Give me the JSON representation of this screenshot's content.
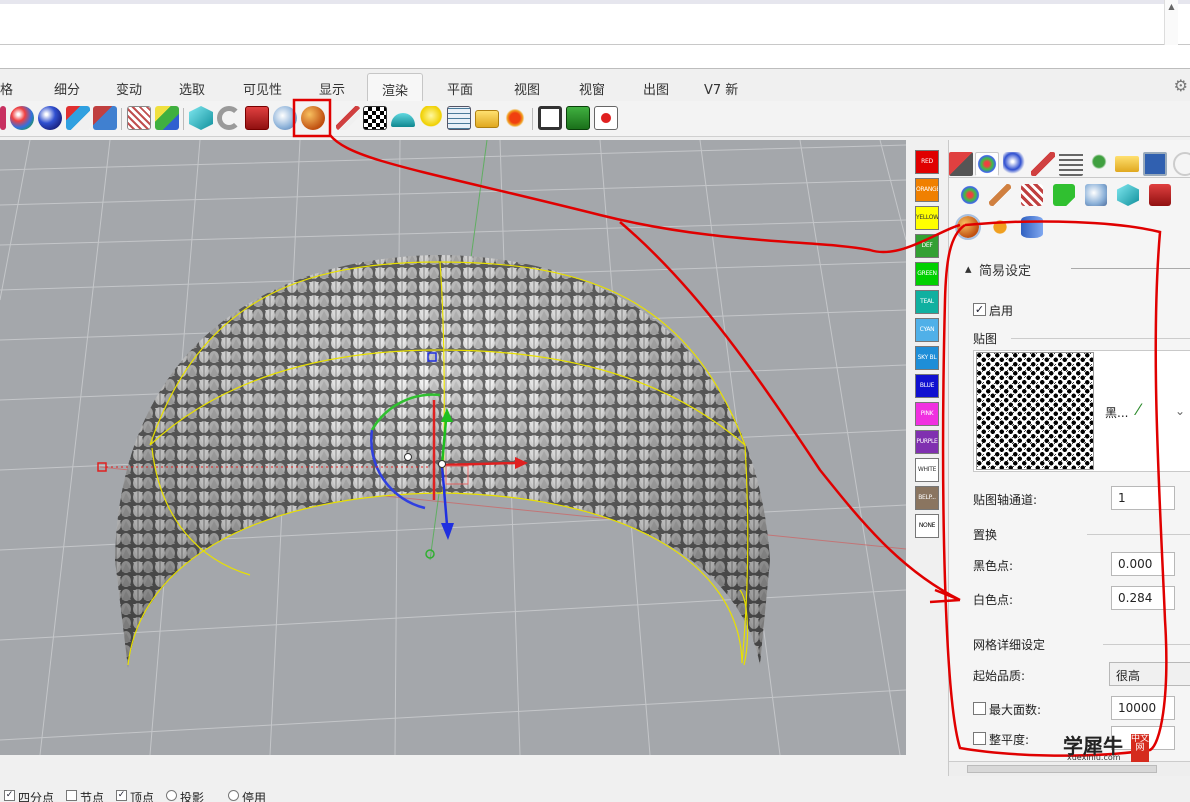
{
  "ribbon_tabs": [
    "格",
    "细分",
    "变动",
    "选取",
    "可见性",
    "显示",
    "渲染",
    "平面",
    "视图",
    "视窗",
    "出图",
    "V7 新"
  ],
  "active_tab": "渲染",
  "toolbar_icons": [
    "material-sphere-icon",
    "render-sphere-icon",
    "render-preview-icon",
    "render-settings-icon",
    "camera-target-icon",
    "color-cube-icon",
    "teal-cube-icon",
    "torus-icon",
    "red-box-icon",
    "glass-icon",
    "displacement-ball-icon",
    "brush-icon",
    "checker-icon",
    "dome-icon",
    "light-bulb-icon",
    "table-grid-icon",
    "folder-icon",
    "sun-icon",
    "film-icon",
    "play-render-icon",
    "record-icon"
  ],
  "swatches": [
    {
      "label": "RED",
      "color": "#e00000",
      "text": "#ffffff"
    },
    {
      "label": "ORANGE",
      "color": "#f08000",
      "text": "#ffffff"
    },
    {
      "label": "YELLOW",
      "color": "#ffff00",
      "text": "#333333"
    },
    {
      "label": "DEF",
      "color": "#33a033",
      "text": "#ffffff"
    },
    {
      "label": "GREEN",
      "color": "#00d000",
      "text": "#ffffff"
    },
    {
      "label": "TEAL",
      "color": "#10b0a0",
      "text": "#ffffff"
    },
    {
      "label": "CYAN",
      "color": "#50b0e8",
      "text": "#ffffff"
    },
    {
      "label": "SKY BL",
      "color": "#1e8ed8",
      "text": "#ffffff"
    },
    {
      "label": "BLUE",
      "color": "#1010d0",
      "text": "#ffffff"
    },
    {
      "label": "PINK",
      "color": "#f030e0",
      "text": "#ffffff"
    },
    {
      "label": "PURPLE",
      "color": "#8030b0",
      "text": "#ffffff"
    },
    {
      "label": "WHITE",
      "color": "#ffffff",
      "text": "#333333"
    },
    {
      "label": "BELP...",
      "color": "#8a7560",
      "text": "#ffffff"
    },
    {
      "label": "NONE",
      "color": "#ffffff",
      "text": "#000000"
    }
  ],
  "panel": {
    "section_simple": "简易设定",
    "enable_label": "启用",
    "enable_checked": true,
    "texture_label": "贴图",
    "texture_name": "黑...",
    "mapping_channel_label": "贴图轴通道:",
    "mapping_channel_value": "1",
    "displacement_label": "置换",
    "black_point_label": "黑色点:",
    "black_point_value": "0.000",
    "white_point_label": "白色点:",
    "white_point_value": "0.284",
    "mesh_detail_label": "网格详细设定",
    "start_quality_label": "起始品质:",
    "start_quality_value": "很高",
    "max_faces_label": "最大面数:",
    "max_faces_value": "10000",
    "smoothness_label": "整平度:"
  },
  "status_bar": [
    "四分点",
    "节点",
    "顶点",
    "投影",
    "停用"
  ],
  "status_checked": [
    true,
    false,
    true,
    false,
    false
  ],
  "watermark": {
    "main": "学犀牛",
    "url": "xuexiniu.com",
    "seal": "中文网"
  },
  "colors": {
    "annotation_red": "#e00000",
    "viewport_bg": "#a4a7ab",
    "edge_yellow": "#e8e000"
  }
}
